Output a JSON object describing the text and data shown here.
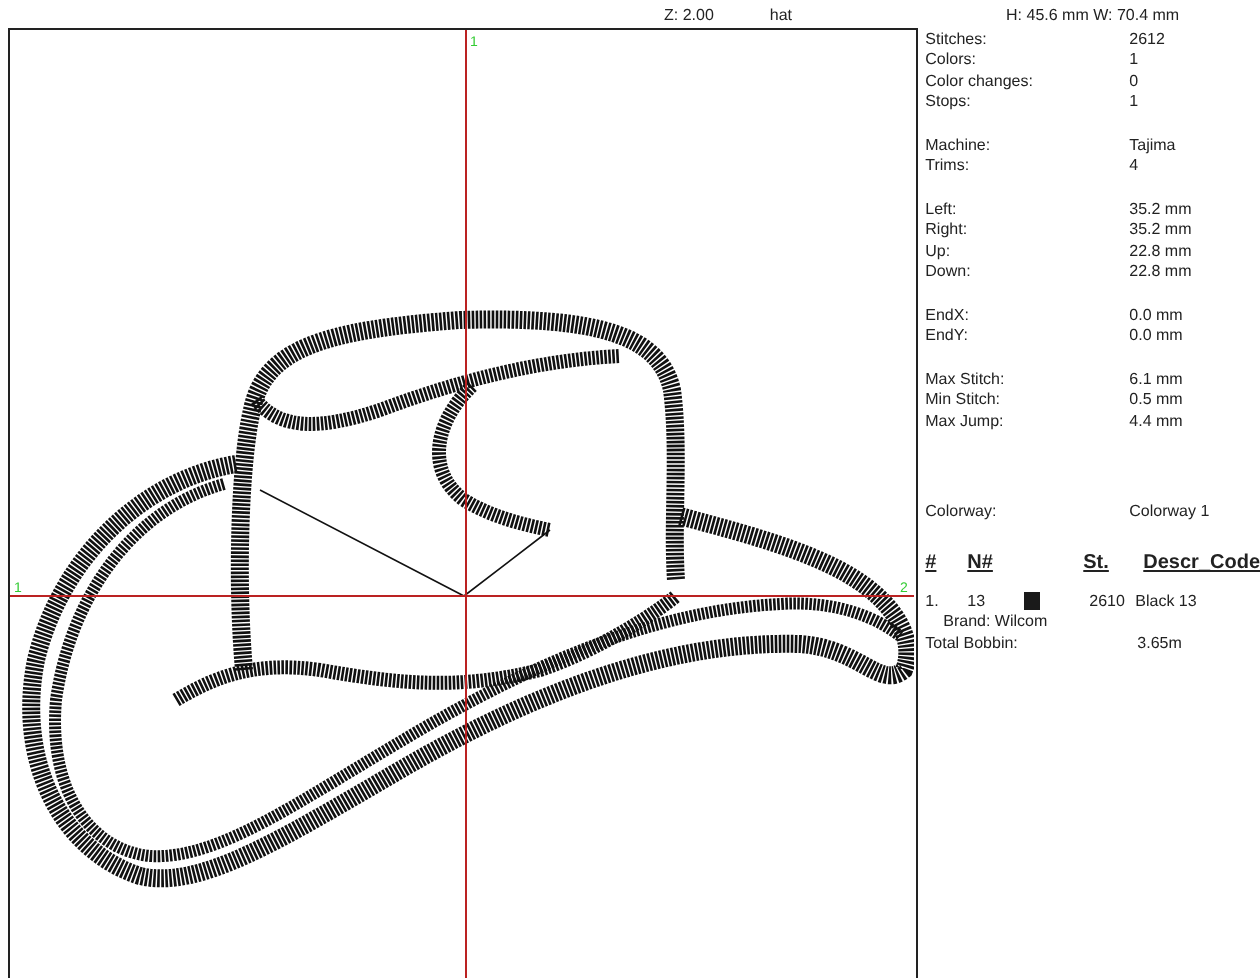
{
  "header": {
    "zoom": "Z: 2.00",
    "design_name": "hat",
    "dimensions": "H: 45.6 mm  W: 70.4 mm"
  },
  "canvas": {
    "top_marker": "1",
    "left_marker": "1",
    "right_marker": "2"
  },
  "stats": [
    [
      {
        "label": "Stitches:",
        "value": "2612"
      },
      {
        "label": "Colors:",
        "value": "1"
      },
      {
        "label": "Color changes:",
        "value": "0"
      },
      {
        "label": "Stops:",
        "value": "1"
      }
    ],
    [
      {
        "label": "Machine:",
        "value": "Tajima"
      },
      {
        "label": "Trims:",
        "value": "4"
      }
    ],
    [
      {
        "label": "Left:",
        "value": "35.2 mm"
      },
      {
        "label": "Right:",
        "value": "35.2 mm"
      },
      {
        "label": "Up:",
        "value": "22.8 mm"
      },
      {
        "label": "Down:",
        "value": "22.8 mm"
      }
    ],
    [
      {
        "label": "EndX:",
        "value": "0.0 mm"
      },
      {
        "label": "EndY:",
        "value": "0.0 mm"
      }
    ],
    [
      {
        "label": "Max Stitch:",
        "value": "6.1 mm"
      },
      {
        "label": "Min Stitch:",
        "value": "0.5 mm"
      },
      {
        "label": "Max Jump:",
        "value": "4.4 mm"
      }
    ]
  ],
  "colorway": {
    "label": "Colorway:",
    "value": "Colorway 1"
  },
  "color_table": {
    "columns": [
      "#",
      "N#",
      "St.",
      "Descr_Code"
    ],
    "rows": [
      {
        "index": "1.",
        "number": "13",
        "color": "#1a1a1a",
        "stitches": "2610",
        "description": "Black 13",
        "brand": "Brand: Wilcom"
      }
    ]
  },
  "total_bobbin": {
    "label": "Total Bobbin:",
    "value": "3.65m"
  }
}
